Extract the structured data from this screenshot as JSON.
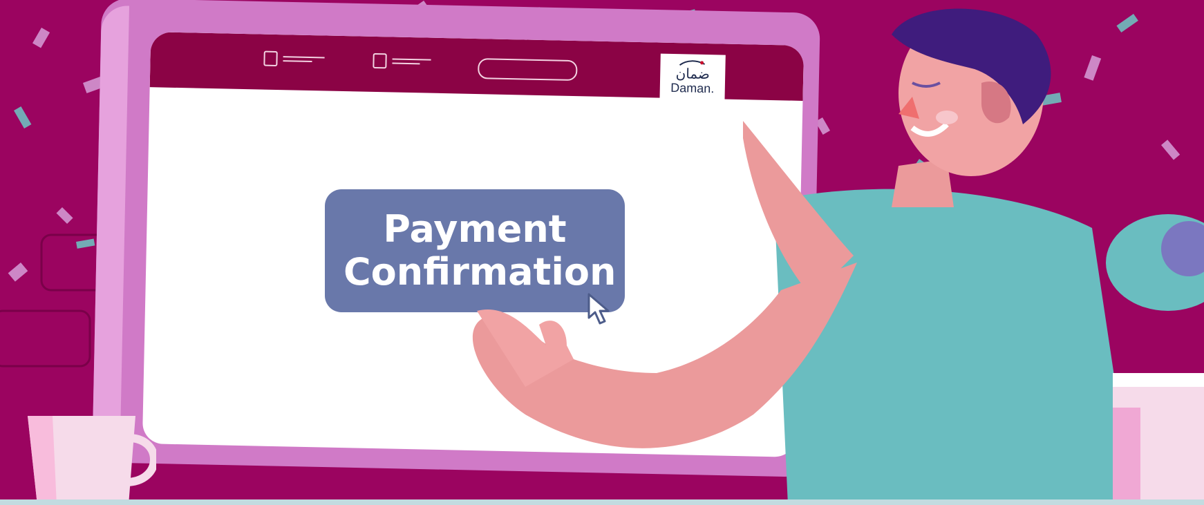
{
  "colors": {
    "background": "#9b0460",
    "monitor_frame": "#d07ac7",
    "topbar": "#8b0345",
    "button": "#6978aa",
    "button_text": "#ffffff",
    "skin": "#eb9a9b",
    "shirt": "#6abdc0",
    "hair": "#3f1c7d",
    "logo_text": "#1f2b4e"
  },
  "header": {
    "logo": {
      "arabic": "ضمان",
      "latin": "Daman."
    }
  },
  "main": {
    "payment_button_label": "Payment Confirmation"
  },
  "icons": {
    "cursor": "mouse-cursor-icon",
    "logo_swoosh": "swoosh-icon"
  }
}
